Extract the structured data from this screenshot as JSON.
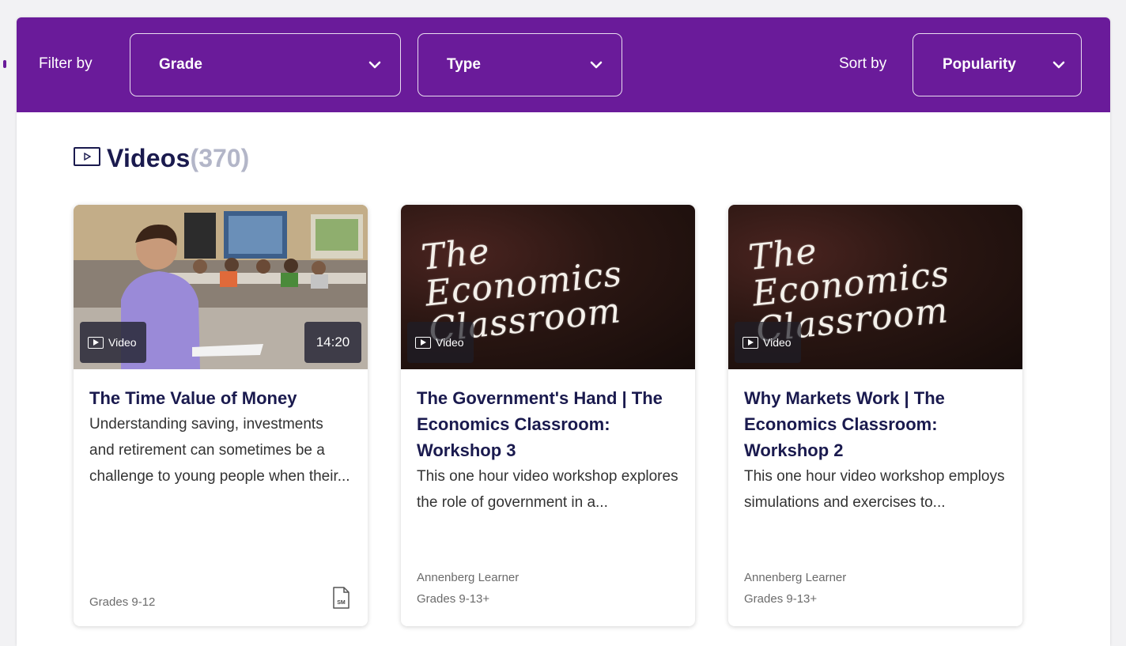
{
  "filter_bar": {
    "filter_label": "Filter by",
    "grade_label": "Grade",
    "type_label": "Type",
    "sort_label": "Sort by",
    "sort_value": "Popularity",
    "color": "#6a1b9a"
  },
  "section": {
    "title": "Videos",
    "count": "(370)",
    "icon": "video-icon"
  },
  "cards": [
    {
      "badge": "Video",
      "duration": "14:20",
      "title": "The Time Value of Money",
      "description": "Understanding saving, investments and retirement can sometimes be a challenge to young people when their...",
      "publisher": "",
      "grades": "Grades 9-12",
      "resource_icon": "sm-document-icon"
    },
    {
      "badge": "Video",
      "thumb_text": "The Economics Classroom",
      "title": "The Government's Hand | The Economics Classroom: Workshop 3",
      "description": "This one hour video workshop explores the role of government in a...",
      "publisher": "Annenberg Learner",
      "grades": "Grades 9-13+"
    },
    {
      "badge": "Video",
      "thumb_text": "The Economics Classroom",
      "title": "Why Markets Work | The Economics Classroom: Workshop 2",
      "description": "This one hour video workshop employs simulations and exercises to...",
      "publisher": "Annenberg Learner",
      "grades": "Grades 9-13+"
    }
  ]
}
